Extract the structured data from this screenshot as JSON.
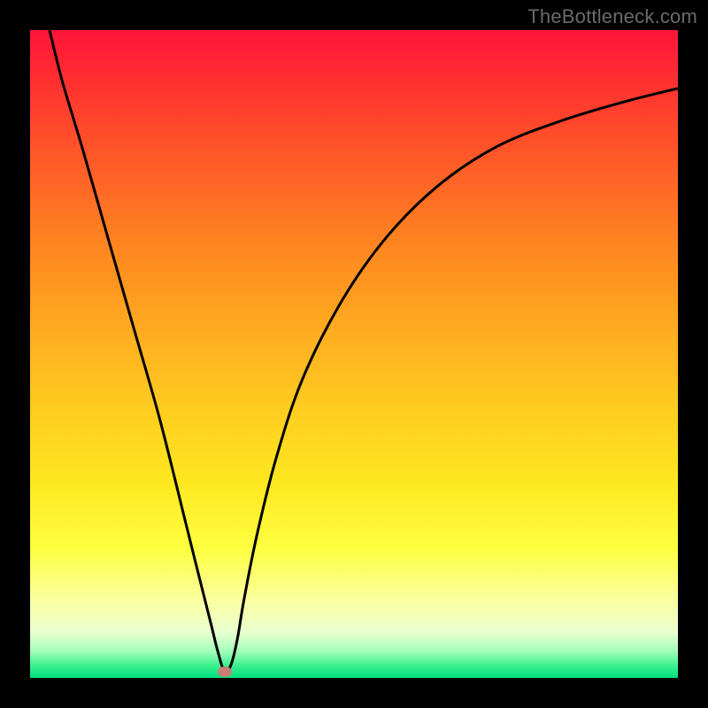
{
  "watermark": "TheBottleneck.com",
  "chart_data": {
    "type": "line",
    "title": "",
    "xlabel": "",
    "ylabel": "",
    "xlim": [
      0,
      100
    ],
    "ylim": [
      0,
      100
    ],
    "grid": false,
    "legend": false,
    "series": [
      {
        "name": "curve",
        "x": [
          3,
          5,
          8,
          12,
          16,
          20,
          24,
          26,
          28,
          29,
          30,
          31,
          32,
          33,
          35,
          38,
          42,
          48,
          55,
          63,
          72,
          82,
          92,
          100
        ],
        "y": [
          100,
          92,
          82,
          68,
          54,
          40,
          24,
          16,
          8,
          4,
          1,
          2,
          6,
          12,
          22,
          34,
          46,
          58,
          68,
          76,
          82,
          86,
          89,
          91
        ]
      }
    ],
    "marker": {
      "x": 30,
      "y": 1,
      "color": "#c97e74"
    },
    "background_gradient": {
      "top": "#ff1438",
      "mid": "#fde820",
      "bottom": "#00e080"
    }
  }
}
